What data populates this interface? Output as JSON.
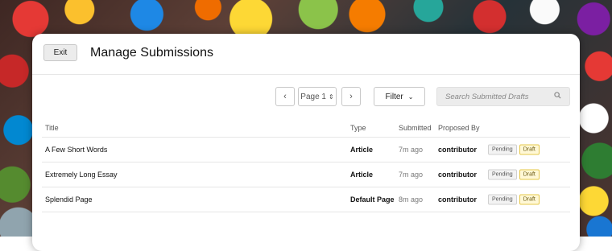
{
  "header": {
    "exit_label": "Exit",
    "title": "Manage Submissions"
  },
  "toolbar": {
    "prev_icon": "chevron-left-icon",
    "next_icon": "chevron-right-icon",
    "page_selected": "Page 1",
    "filter_label": "Filter",
    "search_placeholder": "Search Submitted Drafts"
  },
  "table": {
    "columns": {
      "title": "Title",
      "type": "Type",
      "submitted": "Submitted",
      "proposed_by": "Proposed By"
    },
    "rows": [
      {
        "title": "A Few Short Words",
        "type": "Article",
        "submitted": "7m ago",
        "proposed_by": "contributor",
        "status": "Pending",
        "state": "Draft"
      },
      {
        "title": "Extremely Long Essay",
        "type": "Article",
        "submitted": "7m ago",
        "proposed_by": "contributor",
        "status": "Pending",
        "state": "Draft"
      },
      {
        "title": "Splendid Page",
        "type": "Default Page",
        "submitted": "8m ago",
        "proposed_by": "contributor",
        "status": "Pending",
        "state": "Draft"
      }
    ]
  },
  "colors": {
    "draft_badge_bg": "#fff8d6",
    "draft_badge_border": "#e6c84a"
  }
}
